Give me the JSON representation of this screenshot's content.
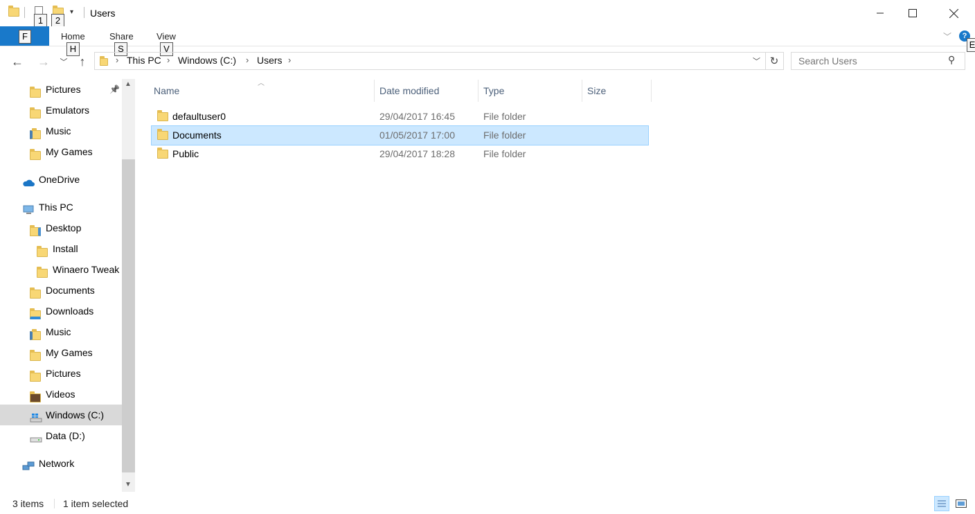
{
  "window": {
    "title": "Users",
    "keytips_qat": [
      "1",
      "2"
    ],
    "minimize_icon": "minimize-icon",
    "maximize_icon": "maximize-icon",
    "close_icon": "close-icon"
  },
  "ribbon": {
    "file_keytip": "F",
    "tabs": [
      {
        "label": "Home",
        "keytip": "H"
      },
      {
        "label": "Share",
        "keytip": "S"
      },
      {
        "label": "View",
        "keytip": "V"
      }
    ],
    "help_keytip": "E"
  },
  "address": {
    "breadcrumbs": [
      "This PC",
      "Windows (C:)",
      "Users"
    ],
    "search_placeholder": "Search Users"
  },
  "sidebar": {
    "items": [
      {
        "label": "Pictures",
        "icon": "pictures-folder-icon",
        "indent": 1,
        "pinned": true
      },
      {
        "label": "Emulators",
        "icon": "folder-icon",
        "indent": 1
      },
      {
        "label": "Music",
        "icon": "music-folder-icon",
        "indent": 1
      },
      {
        "label": "My Games",
        "icon": "folder-icon",
        "indent": 1
      },
      {
        "label": "OneDrive",
        "icon": "onedrive-icon",
        "indent": 0
      },
      {
        "label": "This PC",
        "icon": "this-pc-icon",
        "indent": 0
      },
      {
        "label": "Desktop",
        "icon": "desktop-folder-icon",
        "indent": 1
      },
      {
        "label": "Install",
        "icon": "folder-icon",
        "indent": 2
      },
      {
        "label": "Winaero Tweak",
        "icon": "folder-icon",
        "indent": 2
      },
      {
        "label": "Documents",
        "icon": "documents-folder-icon",
        "indent": 1
      },
      {
        "label": "Downloads",
        "icon": "downloads-folder-icon",
        "indent": 1
      },
      {
        "label": "Music",
        "icon": "music-folder-icon",
        "indent": 1
      },
      {
        "label": "My Games",
        "icon": "folder-icon",
        "indent": 1
      },
      {
        "label": "Pictures",
        "icon": "pictures-folder-icon",
        "indent": 1
      },
      {
        "label": "Videos",
        "icon": "videos-folder-icon",
        "indent": 1
      },
      {
        "label": "Windows (C:)",
        "icon": "windows-drive-icon",
        "indent": 1,
        "selected": true
      },
      {
        "label": "Data (D:)",
        "icon": "drive-icon",
        "indent": 1
      },
      {
        "label": "Network",
        "icon": "network-icon",
        "indent": 0
      }
    ]
  },
  "columns": [
    "Name",
    "Date modified",
    "Type",
    "Size"
  ],
  "files": [
    {
      "name": "defaultuser0",
      "date": "29/04/2017 16:45",
      "type": "File folder",
      "size": ""
    },
    {
      "name": "Documents",
      "date": "01/05/2017 17:00",
      "type": "File folder",
      "size": "",
      "selected": true
    },
    {
      "name": "Public",
      "date": "29/04/2017 18:28",
      "type": "File folder",
      "size": ""
    }
  ],
  "status": {
    "count": "3 items",
    "selection": "1 item selected"
  },
  "colors": {
    "accent": "#1979ca",
    "selection": "#cce8ff",
    "nav_selected": "#d9d9d9"
  }
}
